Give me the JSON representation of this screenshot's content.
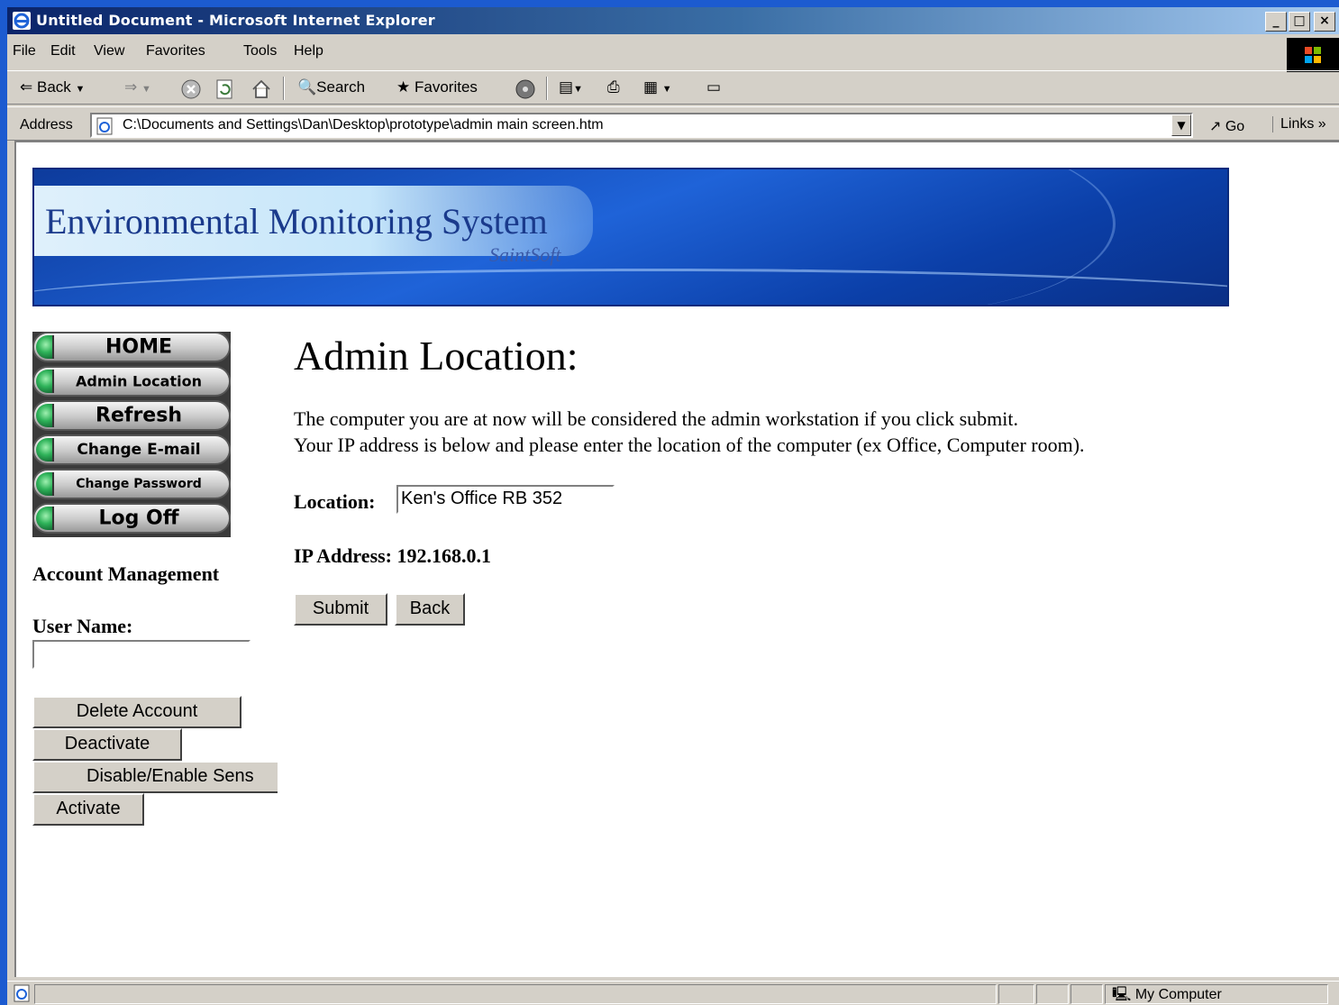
{
  "window": {
    "title": "Untitled Document - Microsoft Internet Explorer",
    "minimize": "_",
    "maximize": "□",
    "close": "×"
  },
  "menu": [
    "File",
    "Edit",
    "View",
    "Favorites",
    "Tools",
    "Help"
  ],
  "toolbar": {
    "back": "Back",
    "search": "Search",
    "favorites": "Favorites"
  },
  "address": {
    "label": "Address",
    "url": "C:\\Documents and Settings\\Dan\\Desktop\\prototype\\admin main screen.htm",
    "go": "Go",
    "links": "Links »"
  },
  "banner": {
    "title": "Environmental Monitoring System",
    "subtitle": "SaintSoft"
  },
  "nav": [
    "HOME",
    "Admin Location",
    "Refresh",
    "Change E-mail",
    "Change Password",
    "Log Off"
  ],
  "sidebar": {
    "section": "Account Management",
    "username_label": "User Name:",
    "username_value": "",
    "buttons": [
      "Delete Account",
      "Deactivate",
      "Disable/Enable Sens",
      "Activate"
    ]
  },
  "main": {
    "heading": "Admin Location:",
    "line1": "The computer you are at now will be considered the admin workstation if you click submit.",
    "line2": "Your IP address is below and please enter the location of the computer (ex Office, Computer room).",
    "location_label": "Location:",
    "location_value": "Ken's Office RB 352",
    "ip_label": "IP Address: 192.168.0.1",
    "submit": "Submit",
    "back": "Back"
  },
  "status": {
    "zone": "My Computer"
  },
  "colors": {
    "titlebar": "#0a246a",
    "banner": "#1f63d8",
    "chrome": "#d4d0c8"
  }
}
